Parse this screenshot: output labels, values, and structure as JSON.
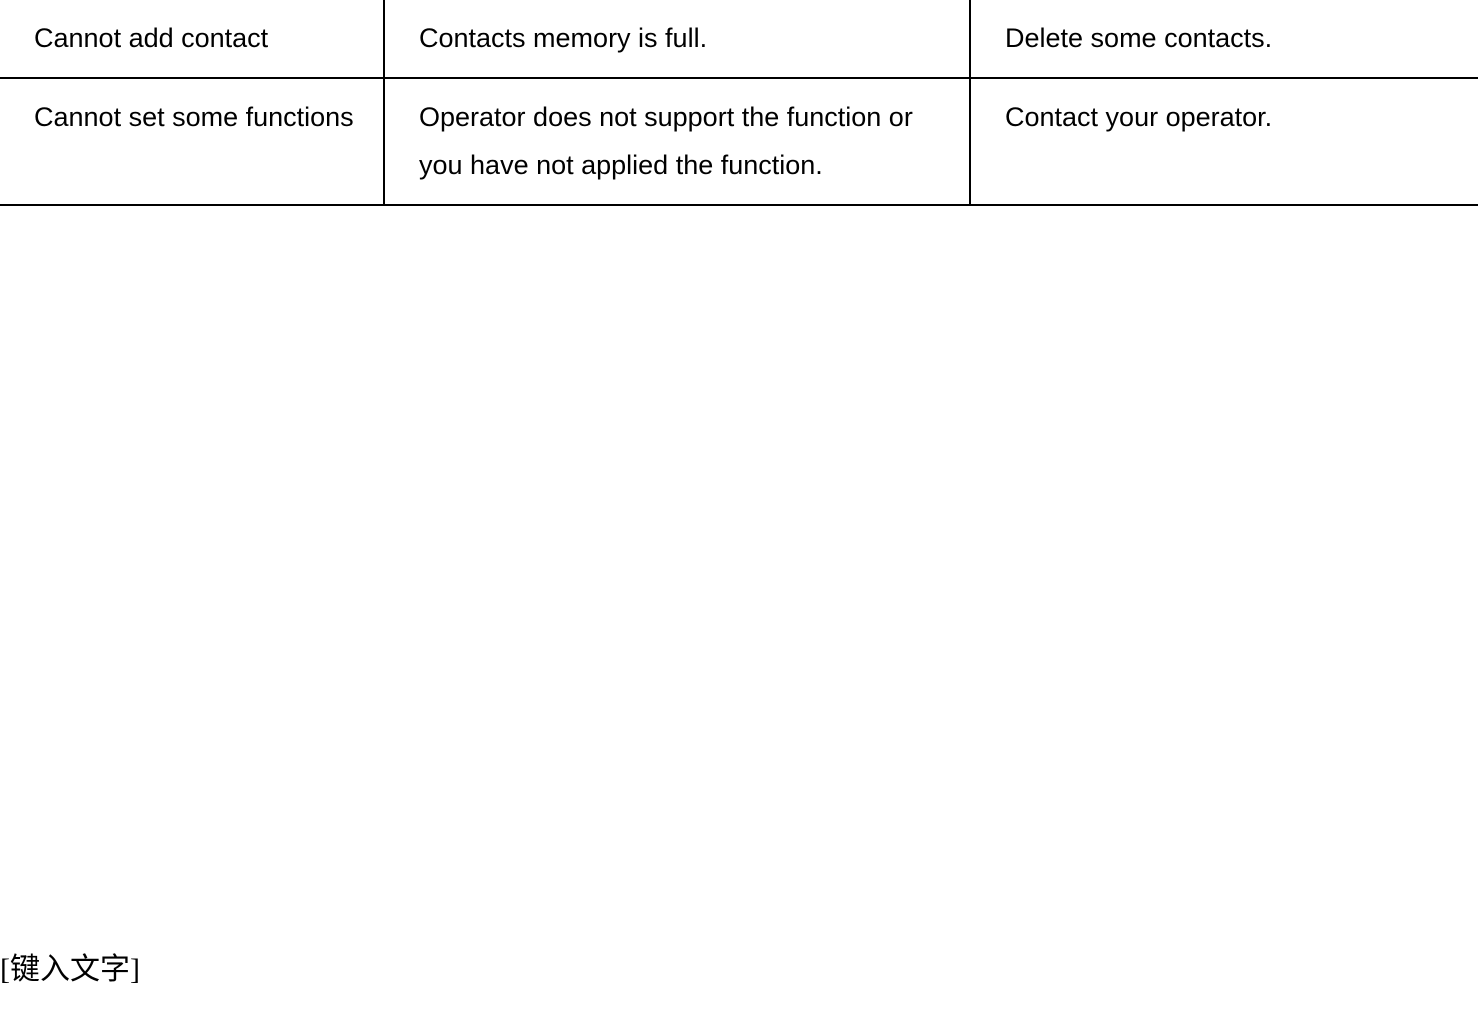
{
  "table": {
    "rows": [
      {
        "problem": "Cannot add contact",
        "cause": "Contacts memory is full.",
        "solution": "Delete some contacts."
      },
      {
        "problem": "Cannot set some functions",
        "cause": "Operator does not support the function or you have not applied the function.",
        "solution": "Contact your operator."
      }
    ]
  },
  "footer": "[键入文字]"
}
